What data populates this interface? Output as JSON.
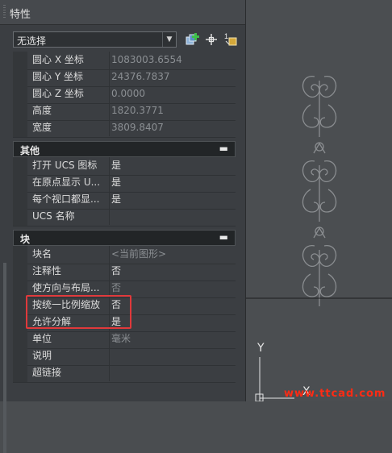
{
  "panel": {
    "title": "特性",
    "selector": {
      "value": "无选择"
    },
    "tools": [
      "quick-select-icon",
      "select-objects-icon",
      "toggle-pickadd-icon"
    ]
  },
  "rows_top": [
    {
      "name": "圆心 X 坐标",
      "value": "1083003.6554",
      "readonly": true
    },
    {
      "name": "圆心 Y 坐标",
      "value": "24376.7837",
      "readonly": true
    },
    {
      "name": "圆心 Z 坐标",
      "value": "0.0000",
      "readonly": true
    },
    {
      "name": "高度",
      "value": "1820.3771",
      "readonly": true
    },
    {
      "name": "宽度",
      "value": "3809.8407",
      "readonly": true
    }
  ],
  "section_other": {
    "title": "其他",
    "collapse": "▬",
    "rows": [
      {
        "name": "打开 UCS 图标",
        "value": "是"
      },
      {
        "name": "在原点显示 U...",
        "value": "是"
      },
      {
        "name": "每个视口都显...",
        "value": "是"
      },
      {
        "name": "UCS 名称",
        "value": ""
      }
    ]
  },
  "section_block": {
    "title": "块",
    "collapse": "▬",
    "rows": [
      {
        "name": "块名",
        "value": "<当前图形>",
        "readonly": true
      },
      {
        "name": "注释性",
        "value": "否"
      },
      {
        "name": "使方向与布局...",
        "value": "否",
        "readonly": true
      },
      {
        "name": "按统一比例缩放",
        "value": "否"
      },
      {
        "name": "允许分解",
        "value": "是"
      },
      {
        "name": "单位",
        "value": "毫米",
        "readonly": true
      },
      {
        "name": "说明",
        "value": ""
      },
      {
        "name": "超链接",
        "value": ""
      }
    ]
  },
  "canvas": {
    "ucs_label_y": "Y",
    "ucs_label_x": "X",
    "watermark": "www.ttcad.com"
  },
  "colors": {
    "highlight": "#e0393b",
    "watermark": "#ff2b14"
  }
}
